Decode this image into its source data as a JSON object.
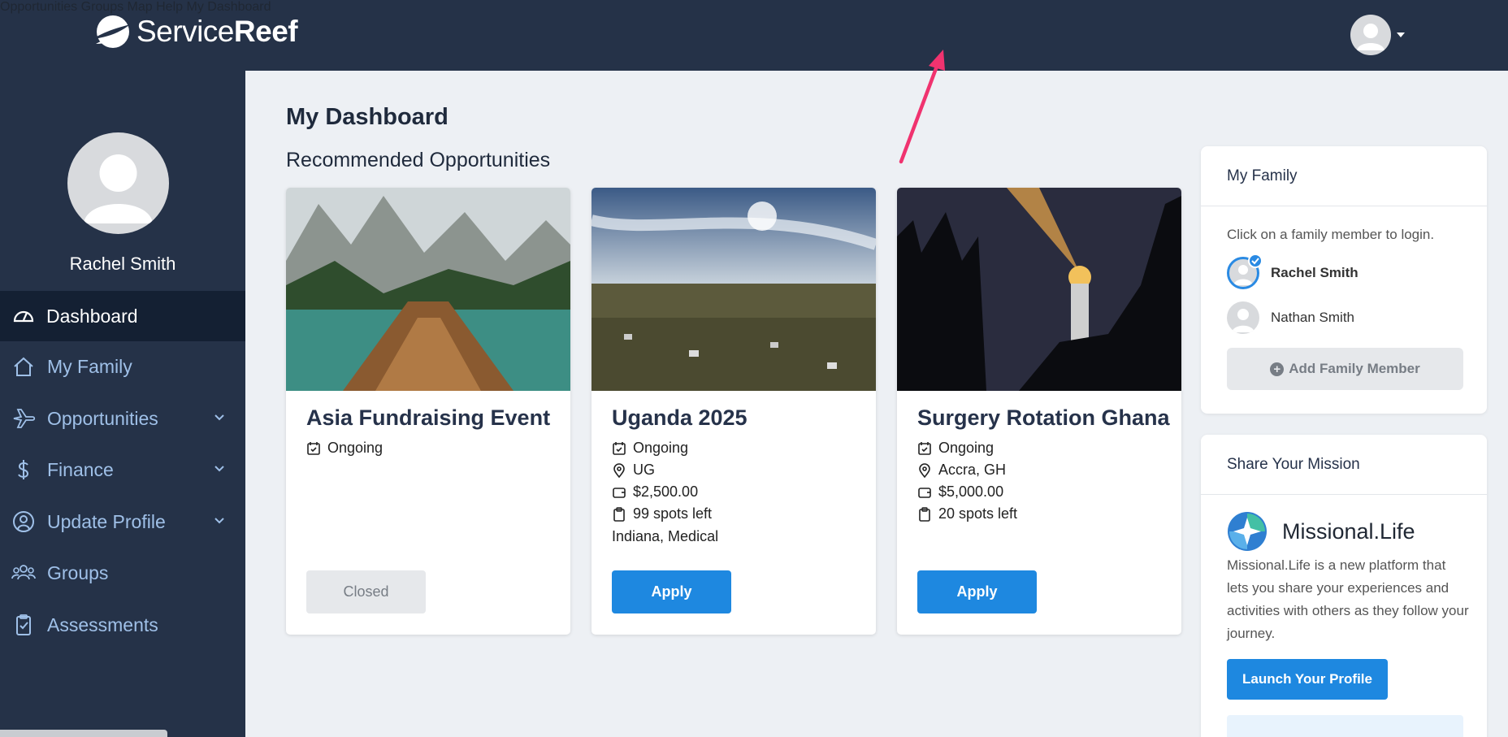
{
  "brand": {
    "name_light": "Service",
    "name_bold": "Reef"
  },
  "topnav": {
    "items": [
      "Opportunities",
      "Groups",
      "Map",
      "Help",
      "My Dashboard"
    ]
  },
  "sidebar": {
    "user_name": "Rachel Smith",
    "items": [
      {
        "label": "Dashboard",
        "icon": "dashboard-icon",
        "active": true
      },
      {
        "label": "My Family",
        "icon": "home-icon"
      },
      {
        "label": "Opportunities",
        "icon": "plane-icon",
        "expandable": true
      },
      {
        "label": "Finance",
        "icon": "dollar-icon",
        "expandable": true
      },
      {
        "label": "Update Profile",
        "icon": "user-circle-icon",
        "expandable": true
      },
      {
        "label": "Groups",
        "icon": "users-icon"
      },
      {
        "label": "Assessments",
        "icon": "clipboard-check-icon"
      }
    ]
  },
  "main": {
    "title": "My Dashboard",
    "section_title": "Recommended Opportunities",
    "cards": [
      {
        "title": "Asia Fundraising Event",
        "status": "Ongoing",
        "button": "Closed"
      },
      {
        "title": "Uganda 2025",
        "status": "Ongoing",
        "location": "UG",
        "cost": "$2,500.00",
        "spots": "99 spots left",
        "tags": "Indiana, Medical",
        "button": "Apply"
      },
      {
        "title": "Surgery Rotation Ghana",
        "status": "Ongoing",
        "location": "Accra, GH",
        "cost": "$5,000.00",
        "spots": "20 spots left",
        "button": "Apply"
      }
    ]
  },
  "family_panel": {
    "title": "My Family",
    "note": "Click on a family member to login.",
    "members": [
      {
        "name": "Rachel Smith",
        "selected": true
      },
      {
        "name": "Nathan Smith",
        "selected": false
      }
    ],
    "add_label": "Add Family Member"
  },
  "share_panel": {
    "title": "Share Your Mission",
    "app_name": "Missional.Life",
    "description": "Missional.Life is a new platform that lets you share your experiences and activities with others as they follow your journey.",
    "button": "Launch Your Profile"
  },
  "colors": {
    "navy": "#253248",
    "active_nav": "#142033",
    "accent_blue": "#1e88e0",
    "sidebar_text": "#9fc0e8",
    "annotation_arrow": "#f0336f"
  }
}
